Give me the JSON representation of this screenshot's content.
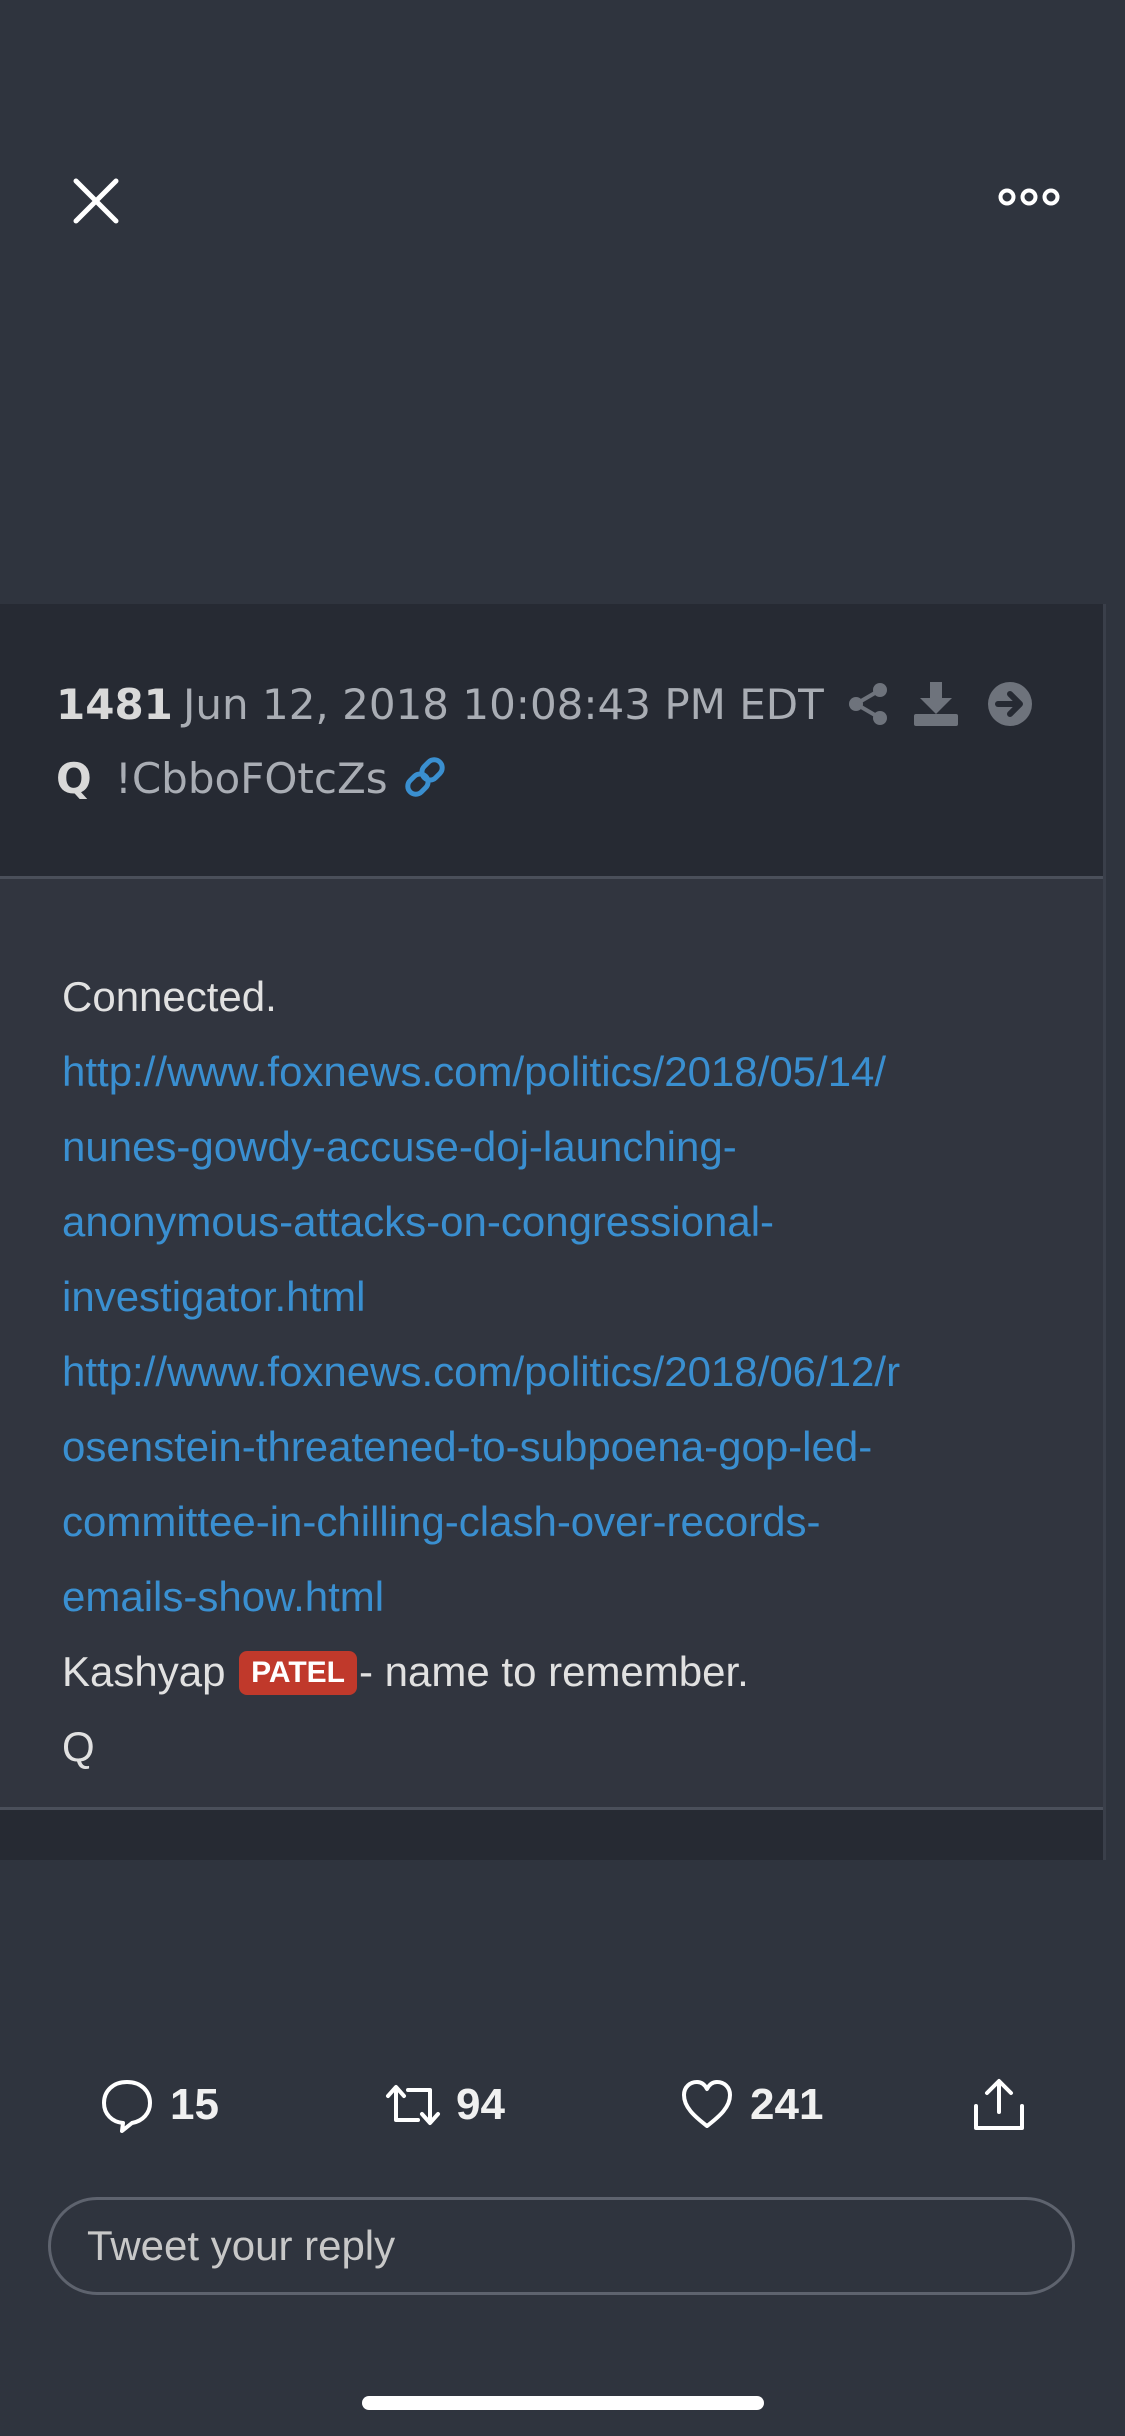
{
  "post": {
    "number": "1481",
    "date": "Jun 12, 2018 10:08:43 PM EDT",
    "author": "Q",
    "tripcode": "!CbboFOtcZs",
    "icons": [
      "share-icon",
      "download-icon",
      "arrow-right-circle-icon",
      "link-icon"
    ],
    "body": {
      "line1": "Connected.",
      "link1_line1": "http://www.foxnews.com/politics/2018/05/14/",
      "link1_line2": "nunes-gowdy-accuse-doj-launching-",
      "link1_line3": "anonymous-attacks-on-congressional-",
      "link1_line4": "investigator.html",
      "link2_line1": "http://www.foxnews.com/politics/2018/06/12/r",
      "link2_line2": "osenstein-threatened-to-subpoena-gop-led-",
      "link2_line3": "committee-in-chilling-clash-over-records-",
      "link2_line4": "emails-show.html",
      "line_pre_tag": "Kashyap ",
      "tag": "PATEL",
      "line_post_tag": "- name to remember.",
      "signature": "Q"
    }
  },
  "actions": {
    "replies": "15",
    "retweets": "94",
    "likes": "241"
  },
  "reply": {
    "placeholder": "Tweet your reply"
  },
  "colors": {
    "background": "#2f343e",
    "card": "#262a33",
    "link": "#3a8fd0",
    "tag": "#c0392b"
  }
}
